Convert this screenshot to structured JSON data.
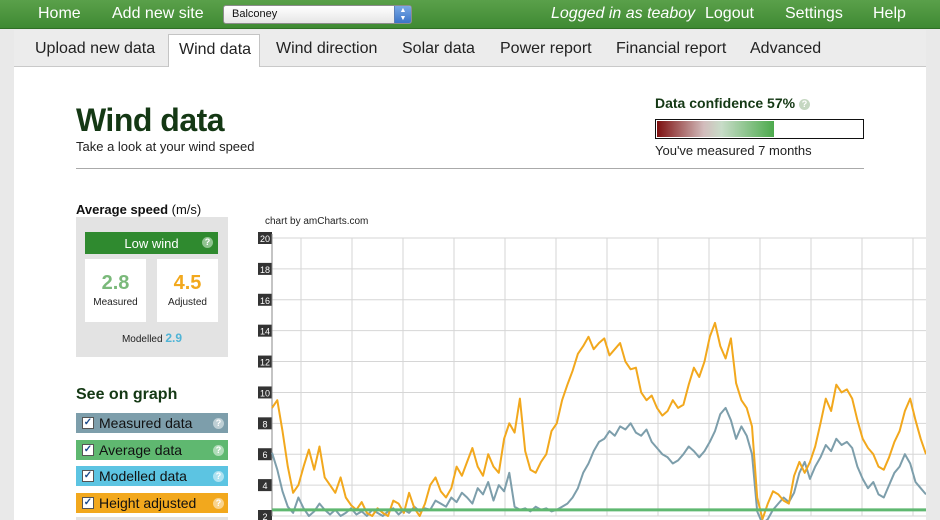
{
  "topnav": {
    "home": "Home",
    "add_site": "Add new site",
    "site_selected": "Balconey",
    "logged_in": "Logged in as teaboy",
    "logout": "Logout",
    "settings": "Settings",
    "help": "Help"
  },
  "tabs": [
    "Upload new data",
    "Wind data",
    "Wind direction",
    "Solar data",
    "Power report",
    "Financial report",
    "Advanced"
  ],
  "active_tab": "Wind data",
  "page": {
    "title": "Wind data",
    "subtitle": "Take a look at your wind speed"
  },
  "confidence": {
    "label": "Data confidence 57%",
    "help": "?",
    "percent": 57,
    "note": "You've measured 7 months"
  },
  "average_speed": {
    "label_bold": "Average speed",
    "unit": "(m/s)",
    "badge": "Low wind",
    "measured_value": "2.8",
    "measured_caption": "Measured",
    "adjusted_value": "4.5",
    "adjusted_caption": "Adjusted",
    "modelled_caption": "Modelled",
    "modelled_value": "2.9"
  },
  "see_graph": {
    "title": "See on graph",
    "items": [
      {
        "label": "Measured data",
        "checked": true,
        "color": "#7d9eab"
      },
      {
        "label": "Average data",
        "checked": true,
        "color": "#5fb870"
      },
      {
        "label": "Modelled data",
        "checked": true,
        "color": "#5cc4e2"
      },
      {
        "label": "Height adjusted",
        "checked": true,
        "color": "#f2a81d"
      }
    ]
  },
  "colors": {
    "accent_green": "#3f8a33",
    "measured": "#7d9eab",
    "average": "#5fb870",
    "adjusted": "#f2a81d"
  },
  "chart_data": {
    "type": "line",
    "credit": "chart by amCharts.com",
    "ylim": [
      2,
      20
    ],
    "y_ticks": [
      "2",
      "4",
      "6",
      "8",
      "10",
      "12",
      "14",
      "16",
      "18",
      "20"
    ],
    "grid": true,
    "series": [
      {
        "key": "measured",
        "values": [
          6.1,
          5.0,
          3.6,
          2.6,
          2.2,
          3.2,
          2.5,
          2.0,
          2.3,
          2.8,
          2.4,
          2.1,
          2.4,
          2.0,
          2.2,
          2.5,
          2.1,
          2.3,
          2.0,
          2.4,
          2.2,
          2.0,
          2.3,
          2.5,
          2.1,
          2.4,
          2.2,
          2.6,
          2.3,
          2.5,
          2.4,
          3.0,
          2.8,
          2.6,
          3.2,
          2.9,
          3.5,
          3.2,
          2.8,
          3.8,
          3.4,
          4.2,
          3.0,
          4.0,
          3.6,
          4.8,
          2.6,
          2.4,
          2.5,
          2.3,
          2.6,
          2.4,
          2.5,
          2.3,
          2.4,
          2.6,
          2.8,
          3.2,
          3.8,
          4.8,
          5.4,
          6.2,
          6.8,
          7.0,
          7.5,
          7.2,
          7.8,
          7.6,
          8.0,
          7.4,
          7.2,
          7.6,
          6.8,
          6.4,
          6.0,
          5.8,
          5.4,
          5.6,
          6.0,
          6.5,
          6.2,
          5.8,
          6.2,
          6.8,
          7.5,
          8.6,
          9.0,
          8.2,
          7.0,
          7.8,
          7.2,
          6.0,
          2.3,
          1.5,
          1.8,
          2.4,
          2.8,
          3.2,
          2.9,
          3.5,
          4.8,
          5.5,
          4.4,
          5.2,
          5.8,
          6.6,
          6.2,
          7.0,
          6.6,
          6.8,
          6.4,
          5.2,
          4.4,
          3.8,
          4.2,
          3.4,
          3.2,
          4.0,
          4.8,
          5.2,
          6.0,
          5.4,
          4.2,
          3.8,
          3.4
        ]
      },
      {
        "key": "adjusted",
        "values": [
          9.0,
          9.5,
          7.5,
          5.2,
          3.5,
          4.0,
          5.2,
          6.3,
          5.0,
          6.5,
          4.5,
          4.0,
          3.5,
          4.5,
          3.2,
          2.7,
          2.4,
          2.9,
          2.2,
          2.0,
          2.5,
          2.2,
          2.0,
          3.0,
          2.8,
          2.2,
          3.5,
          2.5,
          2.0,
          2.8,
          4.0,
          4.5,
          3.6,
          3.2,
          3.8,
          5.2,
          4.6,
          5.5,
          6.4,
          5.2,
          4.6,
          6.0,
          5.2,
          4.8,
          7.0,
          8.0,
          7.4,
          9.6,
          6.2,
          5.0,
          4.8,
          5.5,
          6.0,
          7.5,
          8.0,
          9.5,
          10.5,
          11.4,
          12.5,
          13.0,
          13.6,
          12.8,
          13.2,
          13.5,
          12.4,
          12.8,
          13.2,
          12.0,
          11.5,
          11.6,
          10.0,
          9.5,
          9.8,
          9.0,
          8.5,
          8.8,
          9.5,
          9.0,
          9.2,
          10.5,
          11.6,
          11.0,
          12.0,
          13.6,
          14.5,
          13.0,
          12.2,
          13.5,
          10.6,
          9.5,
          9.0,
          7.8,
          3.2,
          1.8,
          2.8,
          3.6,
          3.4,
          3.0,
          2.8,
          4.6,
          5.5,
          4.8,
          5.5,
          6.5,
          8.0,
          9.6,
          8.8,
          10.5,
          10.0,
          10.2,
          9.6,
          8.2,
          7.0,
          6.4,
          6.0,
          5.2,
          5.0,
          5.8,
          6.8,
          7.5,
          8.8,
          9.6,
          8.2,
          7.0,
          6.0
        ]
      },
      {
        "key": "average",
        "values": [
          2.4
        ]
      }
    ]
  }
}
